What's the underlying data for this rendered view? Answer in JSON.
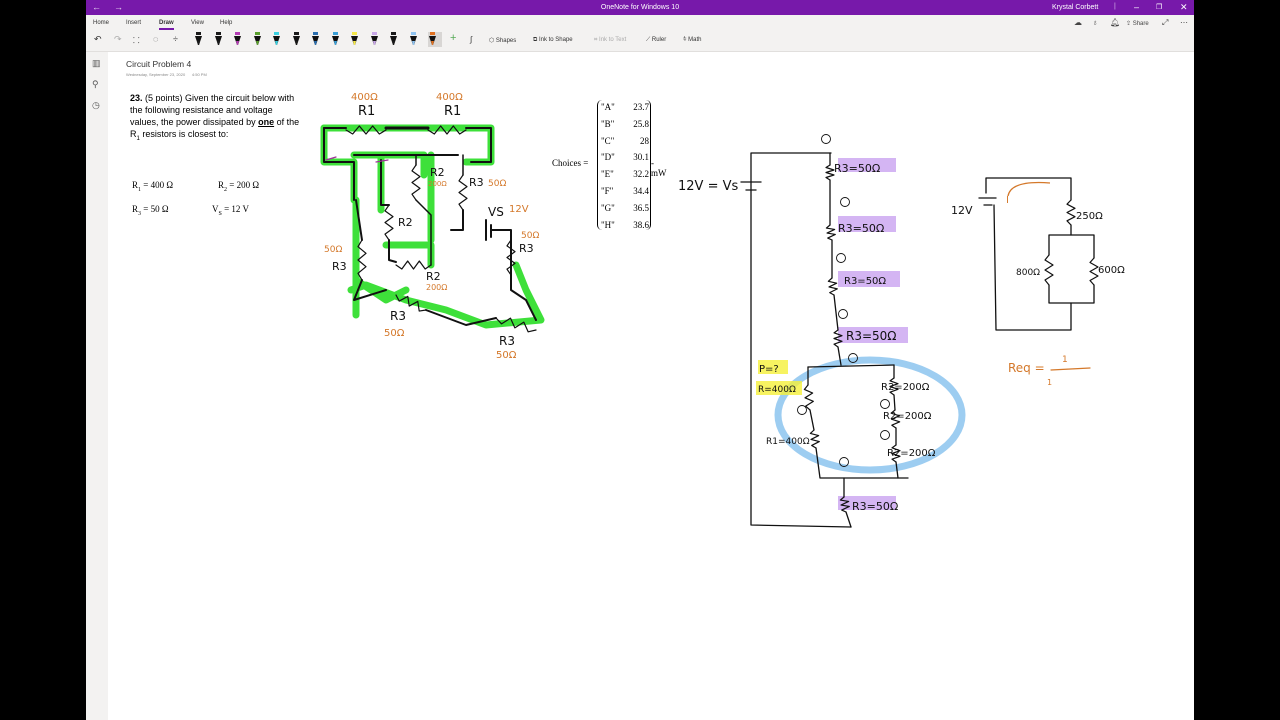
{
  "window": {
    "title": "OneNote for Windows 10",
    "user": "Krystal Corbett",
    "back_icon": "arrow-left-icon",
    "forward_icon": "arrow-right-icon"
  },
  "ribbon": {
    "tabs": [
      "Home",
      "Insert",
      "Draw",
      "View",
      "Help"
    ],
    "active_tab": "Draw",
    "tools": {
      "shapes": "Shapes",
      "ink_to_shape": "Ink to Shape",
      "ink_to_text": "Ink to Text",
      "ruler": "Ruler",
      "math": "Math"
    },
    "pens": [
      "#1a1a1a",
      "#1a1a1a",
      "#b43cb4",
      "#5aa02c",
      "#3ad0e0",
      "#1a1a1a",
      "#2a6fb0",
      "#3aa0d8",
      "#f5e84a",
      "#c9a8e8",
      "#1a1a1a",
      "#8fc3f0",
      "#e07020"
    ],
    "share": "Share"
  },
  "page": {
    "title": "Circuit Problem 4",
    "date": "Wednesday, September 23, 2020",
    "time": "4:50 PM",
    "question_number": "23.",
    "question_text": " (5 points) Given the circuit below with the following resistance and voltage values, the power dissipated by ",
    "question_emph": "one",
    "question_rest": " of the R",
    "question_sub": "1",
    "question_end": " resistors is closest to:",
    "values": [
      {
        "name": "R",
        "sub": "1",
        "value": " = 400 Ω"
      },
      {
        "name": "R",
        "sub": "2",
        "value": " = 200 Ω"
      },
      {
        "name": "R",
        "sub": "3",
        "value": " = 50 Ω"
      },
      {
        "name": "V",
        "sub": "S",
        "value": " = 12 V"
      }
    ],
    "choices_label": "Choices =",
    "choices_unit": "mW",
    "choices": [
      {
        "key": "\"A\"",
        "value": "23.7"
      },
      {
        "key": "\"B\"",
        "value": "25.8"
      },
      {
        "key": "\"C\"",
        "value": "28"
      },
      {
        "key": "\"D\"",
        "value": "30.1"
      },
      {
        "key": "\"E\"",
        "value": "32.2"
      },
      {
        "key": "\"F\"",
        "value": "34.4"
      },
      {
        "key": "\"G\"",
        "value": "36.5"
      },
      {
        "key": "\"H\"",
        "value": "38.6"
      }
    ]
  },
  "ink": {
    "left": {
      "r1a": "R1",
      "r1b": "R1",
      "r1a_val": "400Ω",
      "r1b_val": "400Ω",
      "r2a": "R2",
      "r2a_val": "200Ω",
      "r2b": "R2",
      "r2c": "R2",
      "r2c_val": "200Ω",
      "r3a": "R3",
      "r3a_val": "50Ω",
      "r3b": "R3",
      "r3b_val": "50Ω",
      "r3c": "R3",
      "r3c_val": "50Ω",
      "r3d": "R3",
      "r3d_val": "50Ω",
      "r3e": "R3",
      "r3e_val": "50Ω",
      "vs": "VS",
      "vs_val": "12V"
    },
    "middle": {
      "source": "12V = Vs",
      "r3_1": "R3=50Ω",
      "r3_2": "R3=50Ω",
      "r3_3": "R3=50Ω",
      "r3_4": "R3=50Ω",
      "r3_5": "R3=50Ω",
      "p": "P=?",
      "r": "R=400Ω",
      "r1": "R1=400Ω",
      "r2_1": "R2=200Ω",
      "r2_2": "R2=200Ω",
      "r2_3": "R2=200Ω"
    },
    "right": {
      "source": "12V",
      "current": "I",
      "r250": "250Ω",
      "r800": "800Ω",
      "r600": "600Ω",
      "req": "Req =",
      "one": "1",
      "one2": "1"
    },
    "colors": {
      "green": "#3ee03a",
      "purple": "#c9a2f0",
      "blue": "#8cc4ee",
      "yellow": "#f5f03a",
      "orange": "#d4782a"
    }
  }
}
